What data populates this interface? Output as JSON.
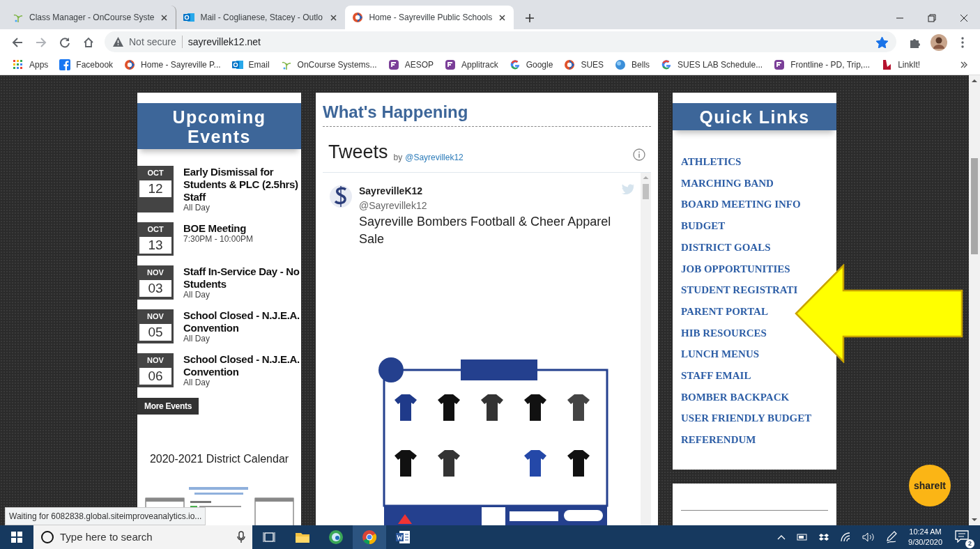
{
  "browser": {
    "tabs": [
      {
        "title": "Class Manager - OnCourse Syste",
        "kind": "oncourse",
        "selected": false
      },
      {
        "title": "Mail - Coglianese, Stacey - Outlo",
        "kind": "outlook",
        "selected": false
      },
      {
        "title": "Home - Sayreville Public Schools",
        "kind": "district",
        "selected": true
      }
    ],
    "address": {
      "security": "Not secure",
      "url": "sayrevillek12.net",
      "bookmarked": true
    },
    "bookmarks": [
      {
        "label": "Apps",
        "kind": "apps"
      },
      {
        "label": "Facebook",
        "kind": "facebook"
      },
      {
        "label": "Home - Sayreville P...",
        "kind": "district"
      },
      {
        "label": "Email",
        "kind": "outlook"
      },
      {
        "label": "OnCourse Systems...",
        "kind": "oncourse"
      },
      {
        "label": "AESOP",
        "kind": "frontline"
      },
      {
        "label": "Applitrack",
        "kind": "frontline"
      },
      {
        "label": "Google",
        "kind": "google"
      },
      {
        "label": "SUES",
        "kind": "district"
      },
      {
        "label": "Bells",
        "kind": "globe"
      },
      {
        "label": "SUES LAB Schedule...",
        "kind": "google"
      },
      {
        "label": "Frontline - PD, Trip,...",
        "kind": "frontline"
      },
      {
        "label": "LinkIt!",
        "kind": "linkit"
      }
    ],
    "status": "Waiting for 6082838.global.siteimproveanalytics.io..."
  },
  "page": {
    "events": {
      "title": "Upcoming Events",
      "items": [
        {
          "month": "OCT",
          "day": "12",
          "title": "Early Dismissal for Students & PLC (2.5hrs) Staff",
          "time": "All Day"
        },
        {
          "month": "OCT",
          "day": "13",
          "title": "BOE Meeting",
          "time": "7:30PM - 10:00PM"
        },
        {
          "month": "NOV",
          "day": "03",
          "title": "Staff In-Service Day - No Students",
          "time": "All Day"
        },
        {
          "month": "NOV",
          "day": "05",
          "title": "School Closed - N.J.E.A. Convention",
          "time": "All Day"
        },
        {
          "month": "NOV",
          "day": "06",
          "title": "School Closed - N.J.E.A. Convention",
          "time": "All Day"
        }
      ],
      "more": "More Events",
      "calendar_title": "2020-2021 District Calendar"
    },
    "happening": {
      "title": "What's Happening",
      "tweets_title": "Tweets",
      "by": "by",
      "by_handle": "@Sayrevillek12",
      "tweet": {
        "name": "SayrevilleK12",
        "handle": "@Sayrevillek12",
        "text": "Sayreville Bombers Football & Cheer Apparel Sale"
      }
    },
    "quick_links": {
      "title": "Quick Links",
      "links": [
        "ATHLETICS",
        "MARCHING BAND",
        "BOARD MEETING INFO",
        "BUDGET",
        "DISTRICT GOALS",
        "JOB OPPORTUNITIES",
        "STUDENT REGISTRATI",
        "PARENT PORTAL",
        "HIB RESOURCES",
        "LUNCH MENUS",
        "STAFF EMAIL",
        "BOMBER BACKPACK",
        "USER FRIENDLY BUDGET",
        "REFERENDUM"
      ]
    },
    "annotation": {
      "kind": "arrow"
    },
    "share_button": "shareIt"
  },
  "taskbar": {
    "search_placeholder": "Type here to search",
    "time": "10:24 AM",
    "date": "9/30/2020",
    "notifications": "2"
  }
}
